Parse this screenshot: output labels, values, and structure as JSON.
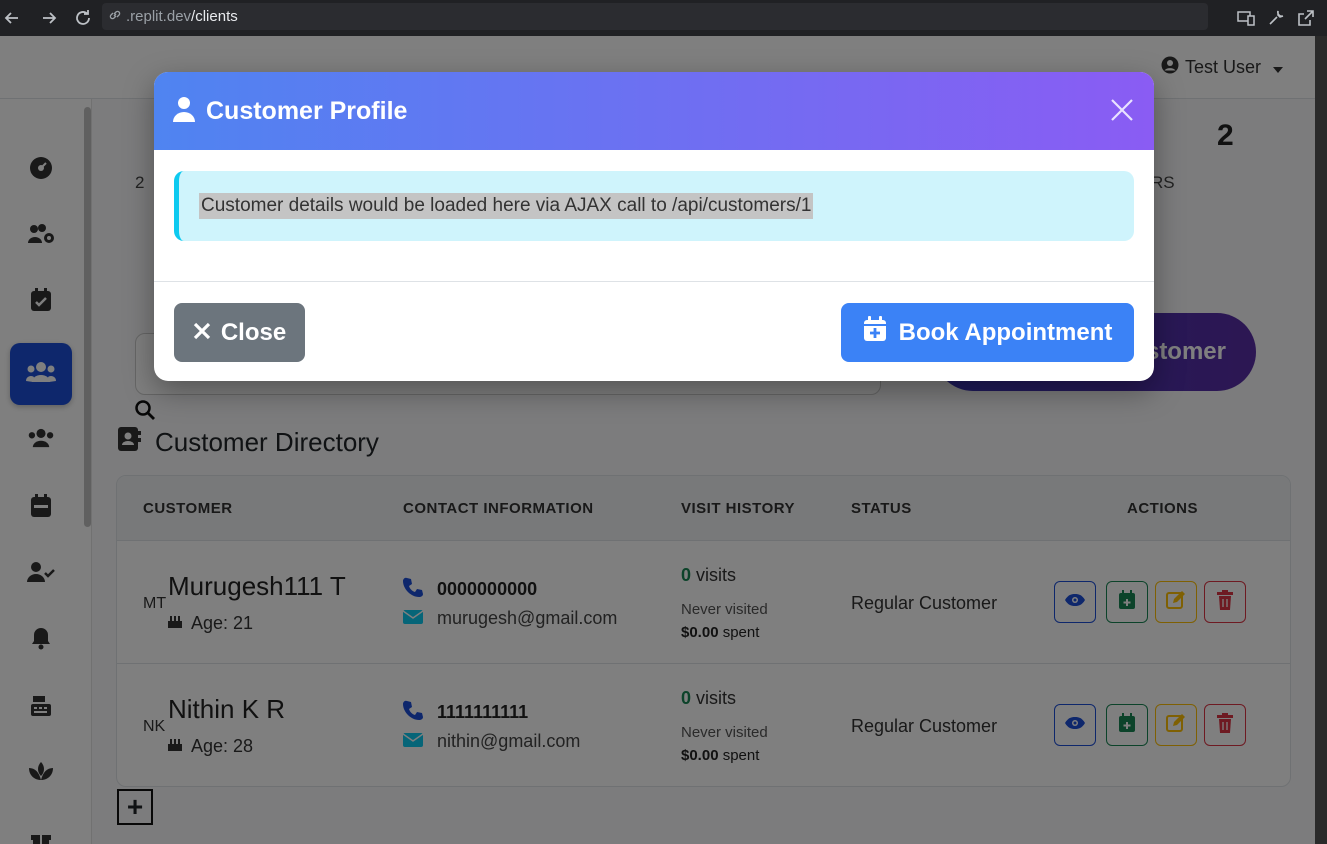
{
  "browser": {
    "url_prefix": ".replit.dev",
    "url_path": "/clients"
  },
  "topbar": {
    "user_name": "Test User"
  },
  "background": {
    "stat_number": "2",
    "stat_fragment_left": "2",
    "stat_fragment_right": "RS",
    "add_button_partial": "stomer",
    "directory_title": "Customer Directory",
    "table": {
      "headers": [
        "CUSTOMER",
        "CONTACT INFORMATION",
        "VISIT HISTORY",
        "STATUS",
        "ACTIONS"
      ],
      "rows": [
        {
          "initials": "MT",
          "name": "Murugesh111 T",
          "age": "Age: 21",
          "phone": "0000000000",
          "email": "murugesh@gmail.com",
          "visits_count": "0",
          "visits_label": "visits",
          "last_visit": "Never visited",
          "spent_amount": "$0.00",
          "spent_label": "spent",
          "status": "Regular Customer"
        },
        {
          "initials": "NK",
          "name": "Nithin K R",
          "age": "Age: 28",
          "phone": "1111111111",
          "email": "nithin@gmail.com",
          "visits_count": "0",
          "visits_label": "visits",
          "last_visit": "Never visited",
          "spent_amount": "$0.00",
          "spent_label": "spent",
          "status": "Regular Customer"
        }
      ]
    },
    "plus_label": "+"
  },
  "modal": {
    "title": "Customer Profile",
    "message": "Customer details would be loaded here via AJAX call to /api/customers/1",
    "close_label": "Close",
    "book_label": "Book Appointment"
  },
  "colors": {
    "header_gradient_start": "#4f84f1",
    "header_gradient_end": "#8a5cf3",
    "alert_bg": "#cff4fc",
    "alert_border": "#0dcaf0",
    "close_btn": "#6c757d",
    "book_btn": "#3b82f6",
    "sidebar_active": "#1d4fd8"
  },
  "icons": {
    "sidebar": [
      "palette-icon",
      "users-cog-icon",
      "calendar-check-icon",
      "users-icon",
      "users-icon",
      "calendar-icon",
      "user-check-icon",
      "bell-icon",
      "cash-register-icon",
      "spa-icon",
      "gift-icon"
    ]
  }
}
